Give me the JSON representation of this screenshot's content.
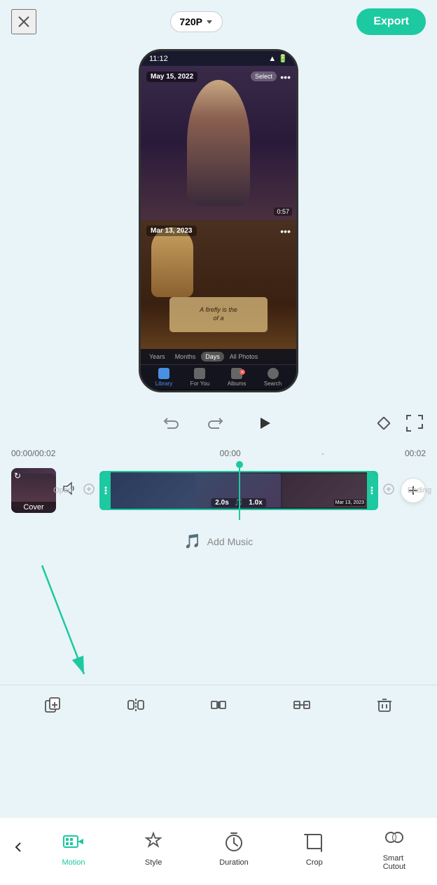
{
  "topBar": {
    "resolution": "720P",
    "exportLabel": "Export"
  },
  "phone": {
    "statusTime": "11:12",
    "video1": {
      "date": "May 15, 2022",
      "selectLabel": "Select",
      "duration": "0:57"
    },
    "video2": {
      "date": "Mar 13, 2023",
      "scrollText": "A firefly is the\nof a"
    },
    "tabFilters": [
      "Years",
      "Months",
      "Days",
      "All Photos"
    ],
    "activeTab": "Days",
    "navItems": [
      "Library",
      "For You",
      "Albums",
      "Search"
    ]
  },
  "timeline": {
    "currentTime": "00:00",
    "totalTime": "00:02",
    "midTime": "00:00",
    "endTime": "00:02",
    "clipDuration": "2.0s",
    "clipSpeed": "1.0x",
    "coverLabel": "Cover",
    "addMusicLabel": "Add Music",
    "openLabel": "Open",
    "endingLabel": "Ending"
  },
  "secondaryToolbar": {
    "tools": [
      {
        "id": "duplicate",
        "icon": "⧉",
        "label": ""
      },
      {
        "id": "split",
        "icon": "⫿",
        "label": ""
      },
      {
        "id": "speed",
        "icon": "⏩",
        "label": ""
      },
      {
        "id": "trim",
        "icon": "✂",
        "label": ""
      },
      {
        "id": "delete",
        "icon": "🗑",
        "label": ""
      }
    ]
  },
  "bottomToolbar": {
    "backLabel": "‹",
    "tools": [
      {
        "id": "motion",
        "label": "Motion",
        "active": true
      },
      {
        "id": "style",
        "label": "Style",
        "active": false
      },
      {
        "id": "duration",
        "label": "Duration",
        "active": false
      },
      {
        "id": "crop",
        "label": "Crop",
        "active": false
      },
      {
        "id": "smartcutout",
        "label": "Smart\nCutout",
        "active": false
      }
    ]
  }
}
